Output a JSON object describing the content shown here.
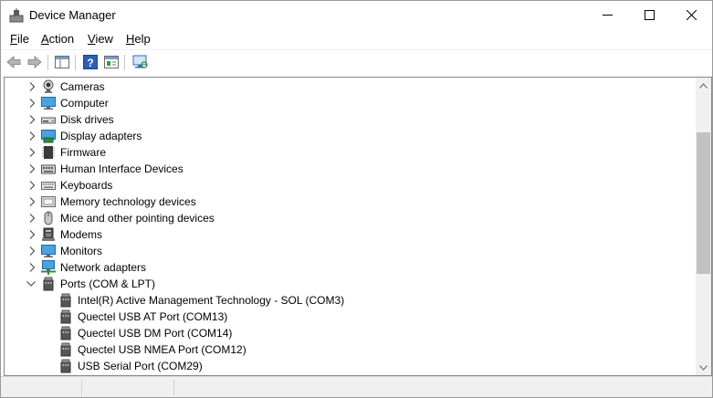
{
  "window": {
    "title": "Device Manager"
  },
  "menu": [
    {
      "key": "F",
      "rest": "ile"
    },
    {
      "key": "A",
      "rest": "ction"
    },
    {
      "key": "V",
      "rest": "iew"
    },
    {
      "key": "H",
      "rest": "elp"
    }
  ],
  "toolbar": {
    "buttons": [
      "back-arrow-icon",
      "forward-arrow-icon",
      "show-hide-console-tree-icon",
      "help-icon",
      "properties-icon",
      "scan-hardware-icon"
    ]
  },
  "tree": {
    "categories": [
      {
        "label": "Cameras",
        "icon": "camera-icon",
        "expanded": false
      },
      {
        "label": "Computer",
        "icon": "computer-icon",
        "expanded": false
      },
      {
        "label": "Disk drives",
        "icon": "disk-drive-icon",
        "expanded": false
      },
      {
        "label": "Display adapters",
        "icon": "display-adapter-icon",
        "expanded": false
      },
      {
        "label": "Firmware",
        "icon": "firmware-icon",
        "expanded": false
      },
      {
        "label": "Human Interface Devices",
        "icon": "hid-icon",
        "expanded": false
      },
      {
        "label": "Keyboards",
        "icon": "keyboard-icon",
        "expanded": false
      },
      {
        "label": "Memory technology devices",
        "icon": "memory-icon",
        "expanded": false
      },
      {
        "label": "Mice and other pointing devices",
        "icon": "mouse-icon",
        "expanded": false
      },
      {
        "label": "Modems",
        "icon": "modem-icon",
        "expanded": false
      },
      {
        "label": "Monitors",
        "icon": "monitor-icon",
        "expanded": false
      },
      {
        "label": "Network adapters",
        "icon": "network-adapter-icon",
        "expanded": false
      },
      {
        "label": "Ports (COM & LPT)",
        "icon": "port-icon",
        "expanded": true
      }
    ],
    "ports": [
      {
        "label": "Intel(R) Active Management Technology - SOL (COM3)",
        "icon": "port-icon"
      },
      {
        "label": "Quectel USB AT Port (COM13)",
        "icon": "port-icon"
      },
      {
        "label": "Quectel USB DM Port (COM14)",
        "icon": "port-icon"
      },
      {
        "label": "Quectel USB NMEA Port (COM12)",
        "icon": "port-icon"
      },
      {
        "label": "USB Serial Port (COM29)",
        "icon": "port-icon"
      }
    ]
  },
  "colors": {
    "accent": "#0078d7",
    "scroll_thumb": "#c2c2c2",
    "statusbar": "#f0f0f0"
  }
}
